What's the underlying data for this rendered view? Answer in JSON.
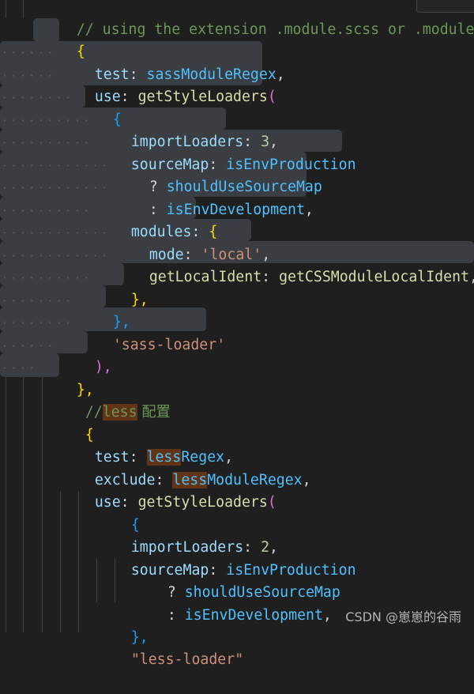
{
  "editor": {
    "lines": [
      {
        "comment": "// using the extension .module.scss or .module.sass"
      },
      {
        "open": "{"
      },
      {
        "key": "test",
        "value": "sassModuleRegex",
        "trail": ","
      },
      {
        "key": "use",
        "fn": "getStyleLoaders",
        "paren": "("
      },
      {
        "open": "{"
      },
      {
        "key": "importLoaders",
        "num": "3",
        "trail": ","
      },
      {
        "key": "sourceMap",
        "value": "isEnvProduction"
      },
      {
        "op": "?",
        "value": "shouldUseSourceMap"
      },
      {
        "op": ":",
        "value": "isEnvDevelopment",
        "trail": ","
      },
      {
        "key": "modules",
        "open": "{"
      },
      {
        "key": "mode",
        "str": "'local'",
        "trail": ","
      },
      {
        "key": "getLocalIdent",
        "fn": "getCSSModuleLocalIdent",
        "trail": ","
      },
      {
        "close": "},"
      },
      {
        "close": "},"
      },
      {
        "str": "'sass-loader'"
      },
      {
        "close": "),"
      },
      {
        "close": "},"
      },
      {
        "comment_prefix": "//",
        "comment_hl": "less",
        "comment_rest": " 配置"
      },
      {
        "open": "{"
      },
      {
        "key": "test",
        "value_hl": "less",
        "value_rest": "Regex",
        "trail": ","
      },
      {
        "key": "exclude",
        "value_hl": "less",
        "value_rest": "ModuleRegex",
        "trail": ","
      },
      {
        "key": "use",
        "fn": "getStyleLoaders",
        "paren": "("
      },
      {
        "open": "{"
      },
      {
        "key": "importLoaders",
        "num": "2",
        "trail": ","
      },
      {
        "key": "sourceMap",
        "value": "isEnvProduction"
      },
      {
        "op": "?",
        "value": "shouldUseSourceMap"
      },
      {
        "op": ":",
        "value": "isEnvDevelopment",
        "trail": ","
      },
      {
        "close": "},"
      },
      {
        "str": "\"less-loader\""
      }
    ]
  },
  "watermark": "CSDN @崽崽的谷雨"
}
